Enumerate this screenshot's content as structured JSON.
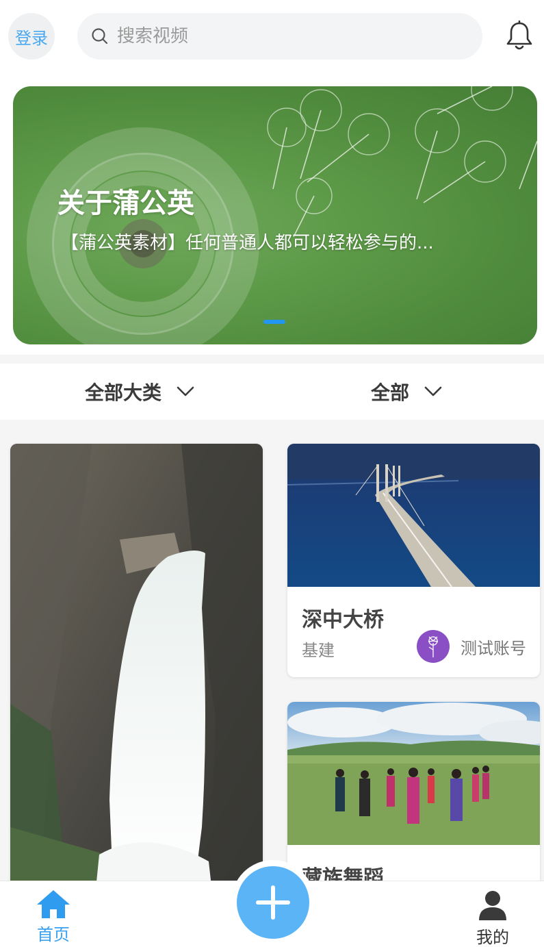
{
  "header": {
    "login_label": "登录",
    "search_placeholder": "搜索视频",
    "notification_icon": "bell-icon"
  },
  "banner": {
    "title": "关于蒲公英",
    "subtitle": "【蒲公英素材】任何普通人都可以轻松参与的...",
    "active_indicator": 1,
    "indicator_color": "#2196f3"
  },
  "filters": [
    {
      "label": "全部大类",
      "icon": "chevron-down-icon"
    },
    {
      "label": "全部",
      "icon": "chevron-down-icon"
    }
  ],
  "feed": {
    "cards": [
      {
        "image": "waterfall-cliff",
        "title": "",
        "category": "",
        "author": ""
      },
      {
        "image": "sea-bridge-night",
        "title": "深中大桥",
        "category": "基建",
        "author": "测试账号"
      },
      {
        "image": "grassland-dancers",
        "title": "藏族舞蹈",
        "category": "",
        "author": ""
      }
    ]
  },
  "bottom_nav": {
    "home_label": "首页",
    "me_label": "我的",
    "add_icon": "plus-icon",
    "active_color": "#3aa0f0"
  }
}
